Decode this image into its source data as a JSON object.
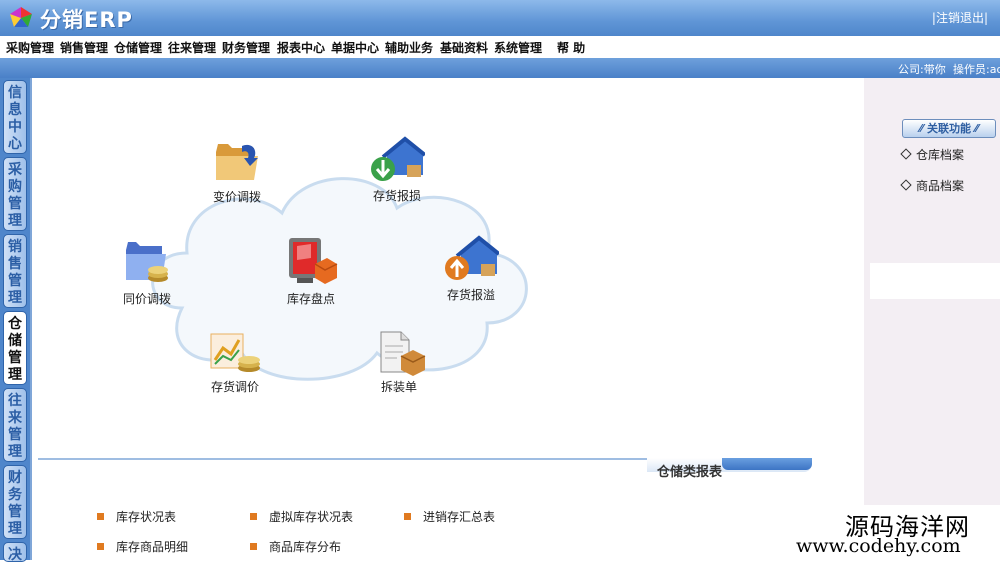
{
  "header": {
    "title": "分销ERP",
    "logout": "|注销退出|"
  },
  "menu": [
    "采购管理",
    "销售管理",
    "仓储管理",
    "往来管理",
    "财务管理",
    "报表中心",
    "单据中心",
    "辅助业务",
    "基础资料",
    "系统管理",
    "帮 助"
  ],
  "info": {
    "company": "公司:带你",
    "operator": "操作员:ad"
  },
  "sidebar": [
    {
      "label": "信息中心"
    },
    {
      "label": "采购管理"
    },
    {
      "label": "销售管理"
    },
    {
      "label": "仓储管理"
    },
    {
      "label": "往来管理"
    },
    {
      "label": "财务管理"
    },
    {
      "label": "决"
    }
  ],
  "functions": {
    "price_transfer": "变价调拨",
    "stock_loss": "存货报损",
    "same_price_transfer": "同价调拨",
    "inventory_count": "库存盘点",
    "stock_overflow": "存货报溢",
    "stock_price_adjust": "存货调价",
    "disassembly": "拆装单"
  },
  "reports": {
    "title": "仓储类报表",
    "items": [
      "库存状况表",
      "虚拟库存状况表",
      "进销存汇总表",
      "库存商品明细",
      "商品库存分布"
    ]
  },
  "related": {
    "button": "关联功能",
    "items": [
      "仓库档案",
      "商品档案"
    ]
  },
  "watermark": {
    "line1": "源码海洋网",
    "line2": "www.codehy.com"
  },
  "colors": {
    "accent": "#4f86cb",
    "bullet": "#e07a20"
  }
}
